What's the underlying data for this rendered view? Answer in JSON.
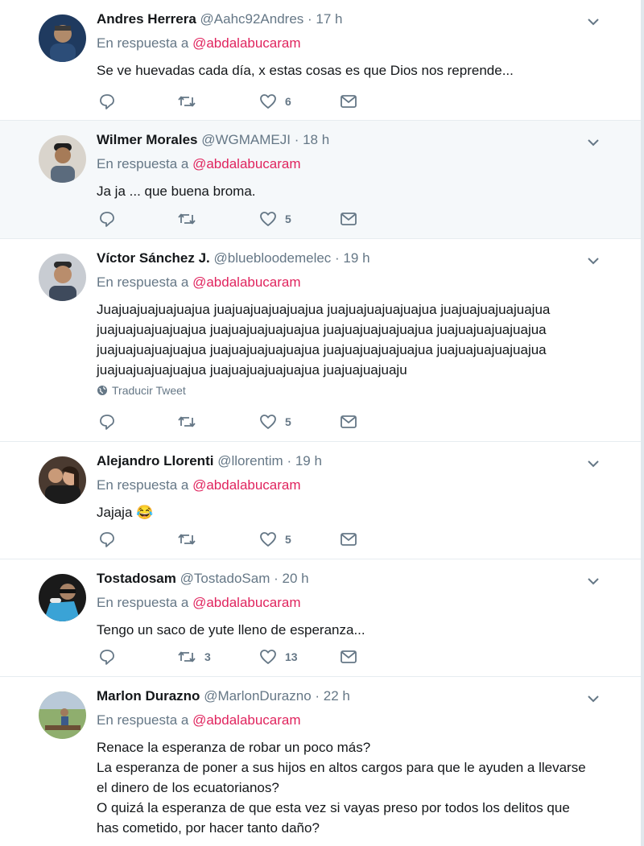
{
  "reply_prefix": "En respuesta a",
  "translate_label": "Traducir Tweet",
  "colors": {
    "mention": "#e0245e",
    "muted": "#657786",
    "text": "#14171a",
    "highlight_bg": "#f5f8fa"
  },
  "tweets": [
    {
      "name": "Andres Herrera",
      "handle": "@Aahc92Andres",
      "time": "· 17 h",
      "reply_to": "@abdalabucaram",
      "text": [
        "Se ve huevadas cada día, x estas cosas es que Dios nos reprende..."
      ],
      "retweets": "",
      "likes": "6"
    },
    {
      "name": "Wilmer Morales",
      "handle": "@WGMAMEJI",
      "time": "· 18 h",
      "reply_to": "@abdalabucaram",
      "text": [
        "Ja ja ... que buena broma."
      ],
      "retweets": "",
      "likes": "5"
    },
    {
      "name": "Víctor Sánchez J.",
      "handle": "@bluebloodemelec",
      "time": "· 19 h",
      "reply_to": "@abdalabucaram",
      "text": [
        "Juajuajuajuajuajua juajuajuajuajuajua juajuajuajuajuajua juajuajuajuajuajua",
        "juajuajuajuajuajua juajuajuajuajuajua juajuajuajuajuajua juajuajuajuajuajua",
        "juajuajuajuajuajua juajuajuajuajuajua juajuajuajuajuajua juajuajuajuajuajua",
        "juajuajuajuajuajua juajuajuajuajuajua juajuajuajuaju"
      ],
      "retweets": "",
      "likes": "5"
    },
    {
      "name": "Alejandro Llorenti",
      "handle": "@llorentim",
      "time": "· 19 h",
      "reply_to": "@abdalabucaram",
      "text": [
        "Jajaja 😂"
      ],
      "retweets": "",
      "likes": "5"
    },
    {
      "name": "Tostadosam",
      "handle": "@TostadoSam",
      "time": "· 20 h",
      "reply_to": "@abdalabucaram",
      "text": [
        "Tengo un saco de yute lleno de esperanza..."
      ],
      "retweets": "3",
      "likes": "13"
    },
    {
      "name": "Marlon Durazno",
      "handle": "@MarlonDurazno",
      "time": "· 22 h",
      "reply_to": "@abdalabucaram",
      "text": [
        "Renace la esperanza de robar un poco más?",
        "La esperanza de poner a sus hijos en altos cargos para que le ayuden a llevarse",
        "el dinero de los ecuatorianos?",
        "O quizá la esperanza de que esta vez si vayas preso por todos los delitos que",
        "has cometido, por hacer tanto daño?"
      ],
      "retweets": "",
      "likes": ""
    }
  ]
}
